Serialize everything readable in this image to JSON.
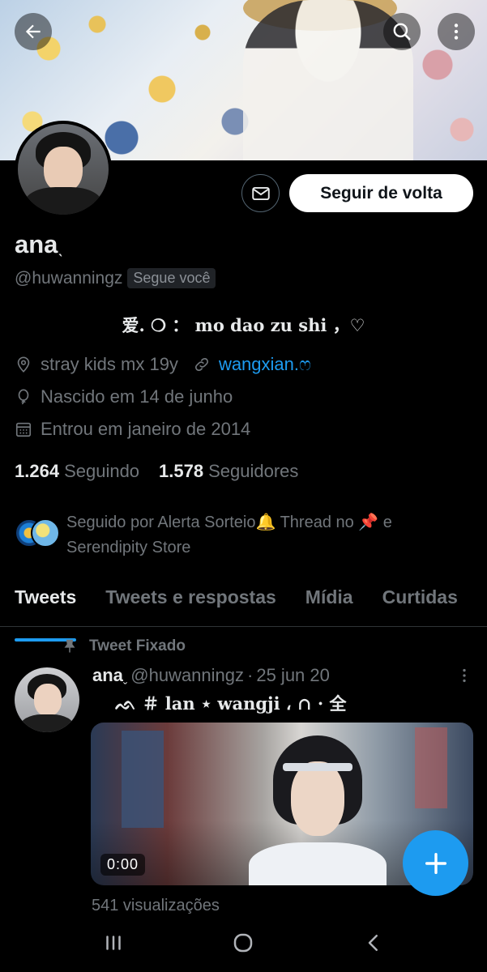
{
  "header": {
    "back_icon": "arrow-left-icon",
    "search_icon": "search-icon",
    "more_icon": "more-vertical-icon"
  },
  "profile": {
    "display_name": "ana",
    "name_suffix": "ˎ",
    "handle": "@huwanningz",
    "follows_you_badge": "Segue você",
    "follow_button_label": "Seguir de volta",
    "bio": "爱. ❍ ： mo dao zu shi ，♡",
    "location": "stray kids mx 19y",
    "website": "wangxian.ෆ",
    "birthday": "Nascido em 14 de junho",
    "joined": "Entrou em janeiro de 2014",
    "following_count": "1.264",
    "following_label": "Seguindo",
    "followers_count": "1.578",
    "followers_label": "Seguidores",
    "followed_by_line1": "Seguido por Alerta Sorteio🔔 Thread no 📌 e",
    "followed_by_line2": "Serendipity Store"
  },
  "tabs": [
    {
      "label": "Tweets",
      "active": true
    },
    {
      "label": "Tweets e respostas",
      "active": false
    },
    {
      "label": "Mídia",
      "active": false
    },
    {
      "label": "Curtidas",
      "active": false
    }
  ],
  "pinned_tweet": {
    "pinned_label": "Tweet Fixado",
    "author_name": "ana",
    "author_name_suffix": "ˬ",
    "author_handle": "@huwanningz",
    "separator": "·",
    "date": "25 jun 20",
    "text": "ᨒ  ＃  lan  ⋆  wangji  ، ∩ · 全",
    "video_time": "0:00",
    "views": "541 visualizações"
  },
  "colors": {
    "accent": "#1d9bf0",
    "background": "#000000",
    "text_primary": "#e7e9ea",
    "text_secondary": "#71767b"
  }
}
